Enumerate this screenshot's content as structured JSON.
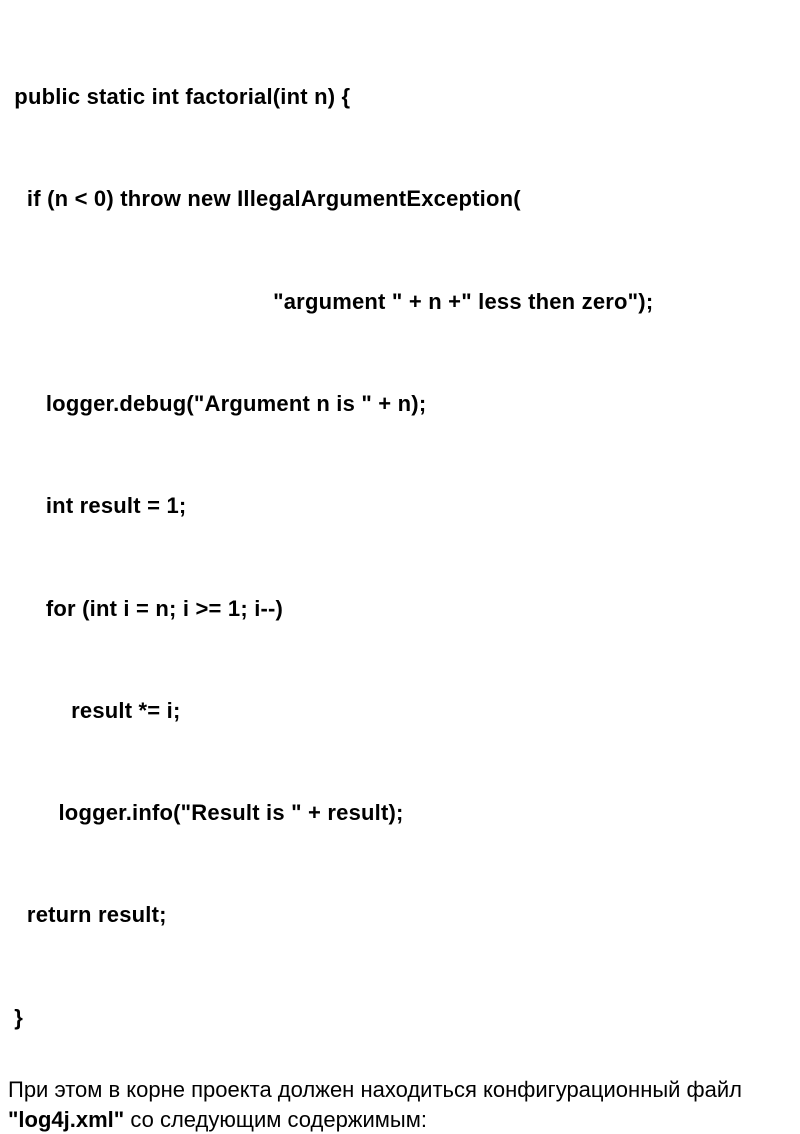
{
  "code": {
    "lines": [
      " public static int factorial(int n) {",
      "   if (n < 0) throw new IllegalArgumentException(",
      "                                          \"argument \" + n +\" less then zero\");",
      "      logger.debug(\"Argument n is \" + n);",
      "      int result = 1;",
      "      for (int i = n; i >= 1; i--)",
      "          result *= i;",
      "        logger.info(\"Result is \" + result);",
      "   return result;",
      " }"
    ]
  },
  "prose": {
    "before": "При этом в корне проекта должен находиться конфигурационный файл ",
    "bold": "\"log4j.xml\"",
    "after": " со следующим содержимым:"
  }
}
